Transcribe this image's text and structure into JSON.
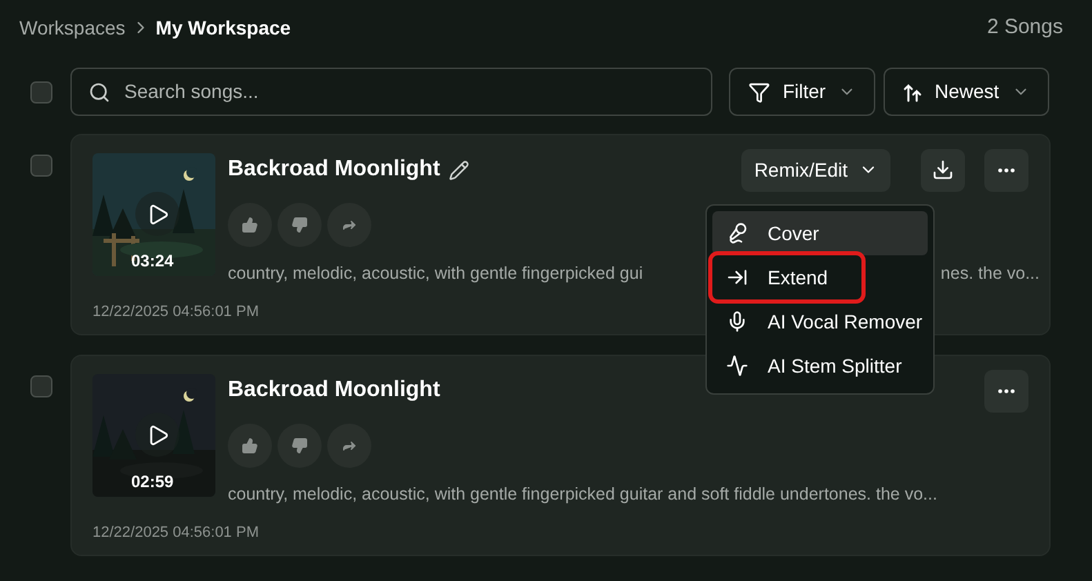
{
  "breadcrumb": {
    "items": [
      "Workspaces",
      "My Workspace"
    ],
    "count": "2 Songs"
  },
  "toolbar": {
    "select_all_checked": false,
    "search": {
      "placeholder": "Search songs..."
    },
    "filter": "Filter",
    "sort": "Newest"
  },
  "songs": [
    {
      "checked": false,
      "title": "Backroad Moonlight",
      "editable": true,
      "duration": "03:24",
      "description_parts": [
        "country, melodic, acoustic, with gentle fingerpicked gui",
        "nes. the vo..."
      ],
      "date": "12/22/2025 04:56:01 PM",
      "actions": [
        {
          "kind": "remix",
          "label": "Remix/Edit"
        },
        {
          "kind": "download"
        },
        {
          "kind": "more"
        }
      ],
      "menu": [
        {
          "kind": "cover",
          "label": "Cover",
          "hovered": true,
          "annotated": false
        },
        {
          "kind": "extend",
          "label": "Extend",
          "hovered": false,
          "annotated": true
        },
        {
          "kind": "vocal",
          "label": "AI Vocal Remover",
          "hovered": false,
          "annotated": false
        },
        {
          "kind": "stem",
          "label": "AI Stem Splitter",
          "hovered": false,
          "annotated": false
        }
      ]
    },
    {
      "checked": false,
      "title": "Backroad Moonlight",
      "editable": false,
      "duration": "02:59",
      "description_parts": [
        "country, melodic, acoustic, with gentle fingerpicked guitar and soft fiddle undertones. the vo..."
      ],
      "date": "12/22/2025 04:56:01 PM",
      "actions": [
        {
          "kind": "more"
        }
      ]
    }
  ]
}
